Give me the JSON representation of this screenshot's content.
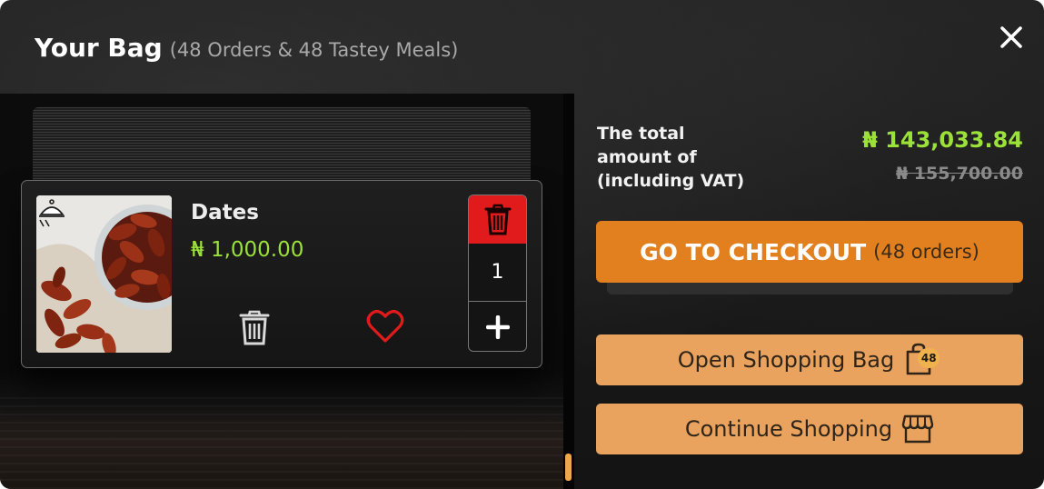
{
  "header": {
    "title": "Your Bag",
    "subtitle": "(48 Orders & 48 Tastey Meals)",
    "close_icon": "close-icon"
  },
  "cart": {
    "item": {
      "name": "Dates",
      "price": "₦ 1,000.00",
      "quantity": "1",
      "image": "dates-photo",
      "icons": [
        "serving-dish-icon",
        "trash-icon",
        "heart-icon",
        "delete-icon",
        "plus-icon"
      ]
    }
  },
  "summary": {
    "total_label": "The total amount of (including VAT)",
    "total_price": "₦ 143,033.84",
    "original_price": "₦ 155,700.00"
  },
  "actions": {
    "checkout_label": "GO TO CHECKOUT",
    "checkout_count": "(48 orders)",
    "open_bag_label": "Open Shopping Bag",
    "bag_badge": "48",
    "continue_label": "Continue Shopping"
  },
  "colors": {
    "accent_green": "#9be13a",
    "checkout_orange": "#e2801f",
    "secondary_orange": "#e9a35e",
    "delete_red": "#e11b1b"
  }
}
